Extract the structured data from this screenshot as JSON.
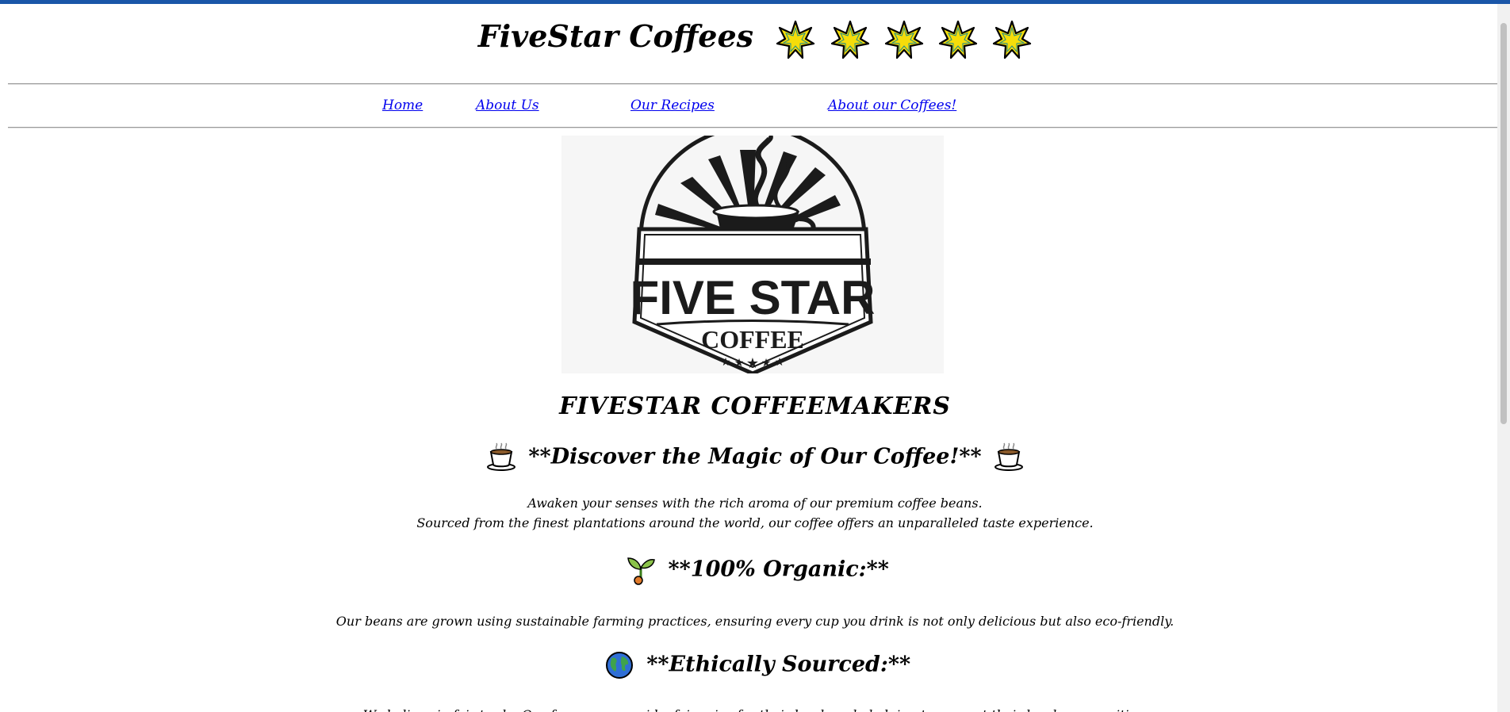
{
  "site": {
    "title": "FiveStar Coffees",
    "star_count": 5,
    "accent_color": "#1a56a8",
    "star_fill": "#f5dd0a"
  },
  "nav": {
    "items": [
      {
        "label": "Home"
      },
      {
        "label": "About Us"
      },
      {
        "label": "Our Recipes"
      },
      {
        "label": "About our Coffees!"
      }
    ]
  },
  "logo": {
    "line1": "FIVE STAR",
    "line2": "COFFEE"
  },
  "main": {
    "heading": "FIVESTAR COFFEEMAKERS",
    "sections": [
      {
        "icon": "coffee-cup-icon",
        "heading": "**Discover the Magic of Our Coffee!**",
        "lines": [
          "Awaken your senses with the rich aroma of our premium coffee beans.",
          "Sourced from the finest plantations around the world, our coffee offers an unparalleled taste experience."
        ]
      },
      {
        "icon": "seedling-icon",
        "heading": "**100% Organic:**",
        "lines": [
          "Our beans are grown using sustainable farming practices, ensuring every cup you drink is not only delicious but also eco-friendly."
        ]
      },
      {
        "icon": "globe-icon",
        "heading": "**Ethically Sourced:**",
        "lines": [
          "We believe in fair trade. Our farmers are paid a fair price for their hard work, helping to support their local communities."
        ]
      }
    ]
  }
}
